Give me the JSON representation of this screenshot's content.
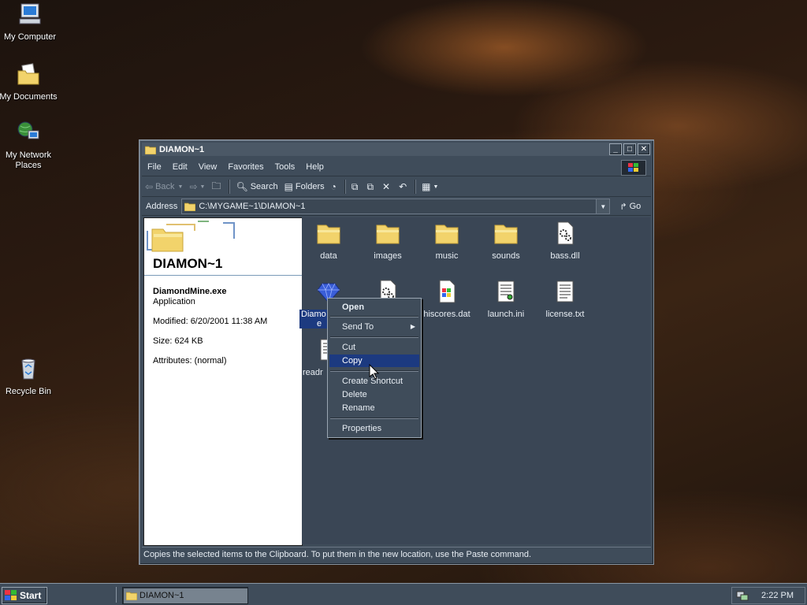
{
  "desktop": {
    "icons": [
      {
        "label": "My Computer"
      },
      {
        "label": "My Documents"
      },
      {
        "label": "My Network Places"
      },
      {
        "label": "Recycle Bin"
      }
    ]
  },
  "window": {
    "title": "DIAMON~1",
    "menu": [
      "File",
      "Edit",
      "View",
      "Favorites",
      "Tools",
      "Help"
    ],
    "toolbar": {
      "back": "Back",
      "search": "Search",
      "folders": "Folders"
    },
    "address": {
      "label": "Address",
      "value": "C:\\MYGAME~1\\DIAMON~1",
      "go": "Go"
    },
    "info": {
      "folder_title": "DIAMON~1",
      "file_name": "DiamondMine.exe",
      "file_type": "Application",
      "modified": "Modified: 6/20/2001 11:38 AM",
      "size": "Size: 624 KB",
      "attributes": "Attributes: (normal)"
    },
    "files": [
      {
        "name": "data",
        "icon": "folder-icon"
      },
      {
        "name": "images",
        "icon": "folder-icon"
      },
      {
        "name": "music",
        "icon": "folder-icon"
      },
      {
        "name": "sounds",
        "icon": "folder-icon"
      },
      {
        "name": "bass.dll",
        "icon": "dll-icon"
      },
      {
        "name": "Diamo",
        "icon": "diamond-icon",
        "name_line2": "e"
      },
      {
        "name": "hiscores.dat",
        "icon": "dat-icon"
      },
      {
        "name": "launch.ini",
        "icon": "ini-icon"
      },
      {
        "name": "license.txt",
        "icon": "txt-icon"
      },
      {
        "name": "readr",
        "icon": "readme-icon"
      }
    ],
    "status": "Copies the selected items to the Clipboard. To put them in the new location, use the Paste command."
  },
  "context_menu": {
    "items": [
      "Open",
      "Send To",
      "Cut",
      "Copy",
      "Create Shortcut",
      "Delete",
      "Rename",
      "Properties"
    ],
    "highlighted": "Copy"
  },
  "taskbar": {
    "start": "Start",
    "task": "DIAMON~1",
    "clock": "2:22 PM"
  }
}
